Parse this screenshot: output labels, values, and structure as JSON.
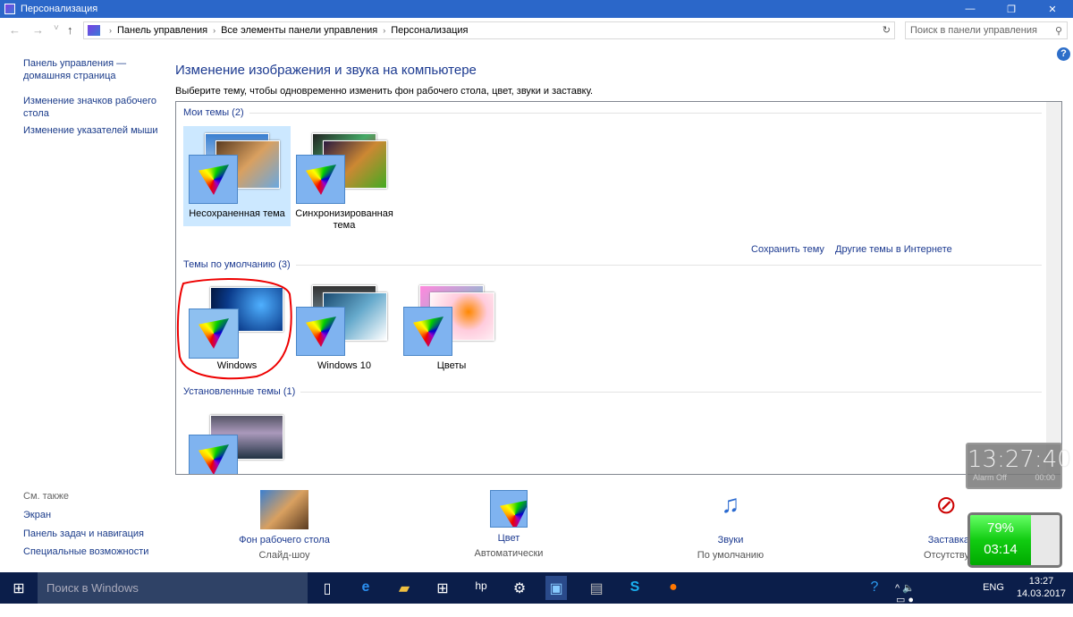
{
  "window": {
    "title": "Персонализация",
    "min": "—",
    "max": "❐",
    "close": "✕"
  },
  "nav": {
    "back": "←",
    "forward": "→",
    "down": "˅",
    "up": "↑",
    "crumbs": [
      "Панель управления",
      "Все элементы панели управления",
      "Персонализация"
    ],
    "sep": "›",
    "refresh": "↻",
    "search_placeholder": "Поиск в панели управления",
    "search_icon": "⚲"
  },
  "left": {
    "home": "Панель управления — домашняя страница",
    "icons": "Изменение значков рабочего стола",
    "pointers": "Изменение указателей мыши",
    "see_also": "См. также",
    "screen": "Экран",
    "taskbar": "Панель задач и навигация",
    "access": "Специальные возможности"
  },
  "main": {
    "help": "?",
    "title": "Изменение изображения и звука на компьютере",
    "subtitle": "Выберите тему, чтобы одновременно изменить фон рабочего стола, цвет, звуки и заставку.",
    "my_themes": "Мои темы (2)",
    "default_themes": "Темы по умолчанию (3)",
    "installed_themes": "Установленные темы (1)",
    "themes_my": [
      "Несохраненная тема",
      "Синхронизированная тема"
    ],
    "themes_default": [
      "Windows",
      "Windows 10",
      "Цветы"
    ],
    "save_theme": "Сохранить тему",
    "more_themes": "Другие темы в Интернете"
  },
  "bottom": [
    {
      "label": "Фон рабочего стола",
      "value": "Слайд-шоу"
    },
    {
      "label": "Цвет",
      "value": "Автоматически"
    },
    {
      "label": "Звуки",
      "value": "По умолчанию"
    },
    {
      "label": "Заставка",
      "value": "Отсутству"
    }
  ],
  "clock": {
    "time": "13:27:40",
    "alarm": "Alarm Off",
    "timer": "00:00"
  },
  "battery": {
    "percent_text": "79%",
    "remaining": "03:14",
    "level": 0.79
  },
  "taskbar": {
    "search": "Поиск в Windows",
    "lang": "ENG",
    "time": "13:27",
    "date": "14.03.2017"
  }
}
